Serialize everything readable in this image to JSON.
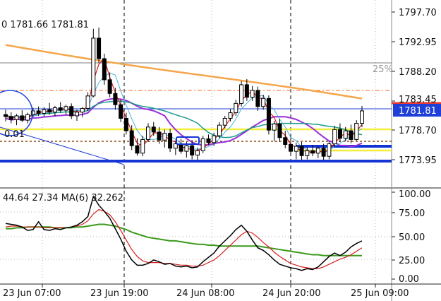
{
  "main_chart": {
    "ohlc_info": "0 1781.66 1781.81",
    "fib_label": "25%",
    "lot_label": "0.01",
    "current_price_label": "1781.81",
    "price_axis": [
      "1797.70",
      "1792.95",
      "1788.20",
      "1783.45",
      "1778.70",
      "1773.95"
    ],
    "colors": {
      "candle": "#000000",
      "ma_slow": "#f5a54a",
      "ma_mid": "#9b30d9",
      "ma_teal": "#1a9c8c",
      "ma_fast": "#d6201f",
      "ma_blue": "#4fb0e0",
      "level_yellow": "#f2ee3a",
      "level_blue": "#1435d6",
      "level_red": "#e53935",
      "price_box": "#1e40d8"
    }
  },
  "indicator": {
    "info": "44.64 27.34 MA(6) 32.262",
    "axis": [
      "100.00",
      "75.00",
      "50.00",
      "25.00",
      "0.00"
    ]
  },
  "time_axis": [
    "23 Jun 07:00",
    "23 Jun 19:00",
    "24 Jun 08:00",
    "24 Jun 20:00",
    "25 Jun 09:00"
  ],
  "chart_data": {
    "type": "candlestick",
    "price_axis_ticks": [
      1797.7,
      1792.95,
      1788.2,
      1783.45,
      1778.7,
      1773.95
    ],
    "indicator_axis_ticks": [
      100,
      75,
      50,
      25,
      0
    ],
    "current_price": 1781.81,
    "candles": [
      [
        1781.2,
        1782.0,
        1780.1,
        1780.9
      ],
      [
        1780.9,
        1781.6,
        1779.8,
        1780.4
      ],
      [
        1780.4,
        1781.3,
        1779.5,
        1781.0
      ],
      [
        1781.0,
        1781.9,
        1780.0,
        1780.3
      ],
      [
        1780.3,
        1781.5,
        1779.8,
        1781.2
      ],
      [
        1781.2,
        1782.3,
        1780.8,
        1781.8
      ],
      [
        1781.8,
        1782.5,
        1781.0,
        1781.4
      ],
      [
        1781.4,
        1782.4,
        1780.9,
        1782.0
      ],
      [
        1782.0,
        1783.1,
        1781.2,
        1781.6
      ],
      [
        1781.6,
        1782.6,
        1780.9,
        1782.3
      ],
      [
        1782.3,
        1783.2,
        1781.5,
        1781.9
      ],
      [
        1781.9,
        1782.8,
        1781.2,
        1782.5
      ],
      [
        1782.5,
        1783.0,
        1780.5,
        1781.0
      ],
      [
        1781.0,
        1782.0,
        1780.2,
        1781.6
      ],
      [
        1781.6,
        1782.4,
        1780.8,
        1782.2
      ],
      [
        1782.2,
        1784.8,
        1781.8,
        1784.2
      ],
      [
        1784.2,
        1795.0,
        1784.0,
        1793.5
      ],
      [
        1793.5,
        1795.2,
        1789.5,
        1790.2
      ],
      [
        1790.2,
        1791.0,
        1786.0,
        1786.8
      ],
      [
        1786.8,
        1788.0,
        1784.0,
        1784.6
      ],
      [
        1784.6,
        1785.5,
        1782.0,
        1782.8
      ],
      [
        1782.8,
        1783.6,
        1780.0,
        1780.6
      ],
      [
        1780.6,
        1781.5,
        1778.0,
        1778.6
      ],
      [
        1778.6,
        1779.5,
        1775.5,
        1776.2
      ],
      [
        1776.2,
        1777.4,
        1774.6,
        1775.0
      ],
      [
        1775.0,
        1777.8,
        1774.5,
        1777.2
      ],
      [
        1777.2,
        1779.8,
        1776.8,
        1779.2
      ],
      [
        1779.2,
        1780.0,
        1777.8,
        1778.4
      ],
      [
        1778.4,
        1779.2,
        1776.5,
        1777.1
      ],
      [
        1777.1,
        1778.8,
        1775.9,
        1778.2
      ],
      [
        1778.2,
        1778.9,
        1775.2,
        1775.8
      ],
      [
        1775.8,
        1777.0,
        1774.7,
        1776.5
      ],
      [
        1776.5,
        1777.3,
        1774.9,
        1775.3
      ],
      [
        1775.3,
        1776.8,
        1774.3,
        1776.2
      ],
      [
        1776.2,
        1777.1,
        1774.0,
        1774.7
      ],
      [
        1774.7,
        1775.9,
        1773.9,
        1775.4
      ],
      [
        1775.4,
        1777.8,
        1775.0,
        1777.3
      ],
      [
        1777.3,
        1778.0,
        1776.3,
        1776.7
      ],
      [
        1776.7,
        1778.3,
        1776.2,
        1777.8
      ],
      [
        1777.8,
        1780.0,
        1777.4,
        1779.5
      ],
      [
        1779.5,
        1781.0,
        1779.0,
        1780.6
      ],
      [
        1780.6,
        1782.1,
        1780.1,
        1781.5
      ],
      [
        1781.5,
        1783.6,
        1781.0,
        1783.0
      ],
      [
        1783.0,
        1786.6,
        1782.5,
        1786.0
      ],
      [
        1786.0,
        1786.9,
        1783.4,
        1784.0
      ],
      [
        1784.0,
        1785.8,
        1783.4,
        1785.1
      ],
      [
        1785.1,
        1785.7,
        1781.8,
        1782.5
      ],
      [
        1782.5,
        1784.4,
        1782.0,
        1783.8
      ],
      [
        1783.8,
        1784.3,
        1778.0,
        1778.7
      ],
      [
        1778.7,
        1780.2,
        1776.9,
        1779.7
      ],
      [
        1779.7,
        1780.5,
        1776.8,
        1777.5
      ],
      [
        1777.5,
        1778.6,
        1775.8,
        1776.4
      ],
      [
        1776.4,
        1777.5,
        1774.8,
        1775.3
      ],
      [
        1775.3,
        1776.7,
        1774.0,
        1776.1
      ],
      [
        1776.1,
        1776.8,
        1773.9,
        1774.6
      ],
      [
        1774.6,
        1776.0,
        1774.0,
        1775.4
      ],
      [
        1775.4,
        1776.3,
        1774.5,
        1775.0
      ],
      [
        1775.0,
        1776.1,
        1774.2,
        1775.8
      ],
      [
        1775.8,
        1776.5,
        1773.9,
        1774.5
      ],
      [
        1774.5,
        1776.9,
        1774.0,
        1776.5
      ],
      [
        1776.5,
        1779.4,
        1776.0,
        1778.8
      ],
      [
        1778.8,
        1779.8,
        1776.8,
        1777.4
      ],
      [
        1777.4,
        1779.2,
        1776.9,
        1778.6
      ],
      [
        1778.6,
        1779.6,
        1776.6,
        1777.2
      ],
      [
        1777.2,
        1780.3,
        1777.0,
        1779.8
      ],
      [
        1779.8,
        1782.6,
        1779.2,
        1781.8
      ]
    ],
    "indicator_series": {
      "black": [
        64,
        63,
        62,
        60,
        56,
        57,
        66,
        57,
        56,
        58,
        57,
        59,
        60,
        62,
        66,
        72,
        95,
        85,
        78,
        70,
        58,
        46,
        32,
        22,
        16,
        16,
        18,
        22,
        20,
        17,
        18,
        15,
        14,
        15,
        13,
        14,
        20,
        25,
        30,
        38,
        44,
        50,
        57,
        62,
        55,
        45,
        36,
        33,
        28,
        22,
        17,
        15,
        13,
        12,
        10,
        12,
        11,
        14,
        20,
        26,
        30,
        27,
        31,
        37,
        41,
        44
      ],
      "red": [
        60,
        61,
        61,
        60,
        60,
        60,
        60,
        59,
        59,
        59,
        59,
        59,
        60,
        61,
        63,
        67,
        75,
        80,
        78,
        74,
        66,
        56,
        45,
        34,
        26,
        21,
        19,
        19,
        19,
        18,
        18,
        17,
        16,
        16,
        15,
        15,
        16,
        19,
        22,
        27,
        33,
        39,
        45,
        51,
        55,
        53,
        48,
        42,
        37,
        31,
        26,
        22,
        18,
        16,
        14,
        13,
        12,
        12,
        14,
        17,
        20,
        23,
        25,
        28,
        32,
        36
      ],
      "green": [
        58,
        58,
        59,
        59,
        60,
        60,
        60,
        60,
        60,
        59,
        59,
        59,
        59,
        60,
        60,
        61,
        62,
        63,
        63,
        62,
        61,
        59,
        57,
        54,
        52,
        50,
        48,
        47,
        46,
        45,
        44,
        44,
        43,
        42,
        41,
        40,
        40,
        39,
        39,
        38,
        38,
        38,
        38,
        38,
        38,
        38,
        38,
        37,
        36,
        35,
        34,
        33,
        32,
        31,
        30,
        29,
        28,
        28,
        27,
        27,
        27,
        27,
        27,
        27,
        27,
        27
      ]
    }
  }
}
